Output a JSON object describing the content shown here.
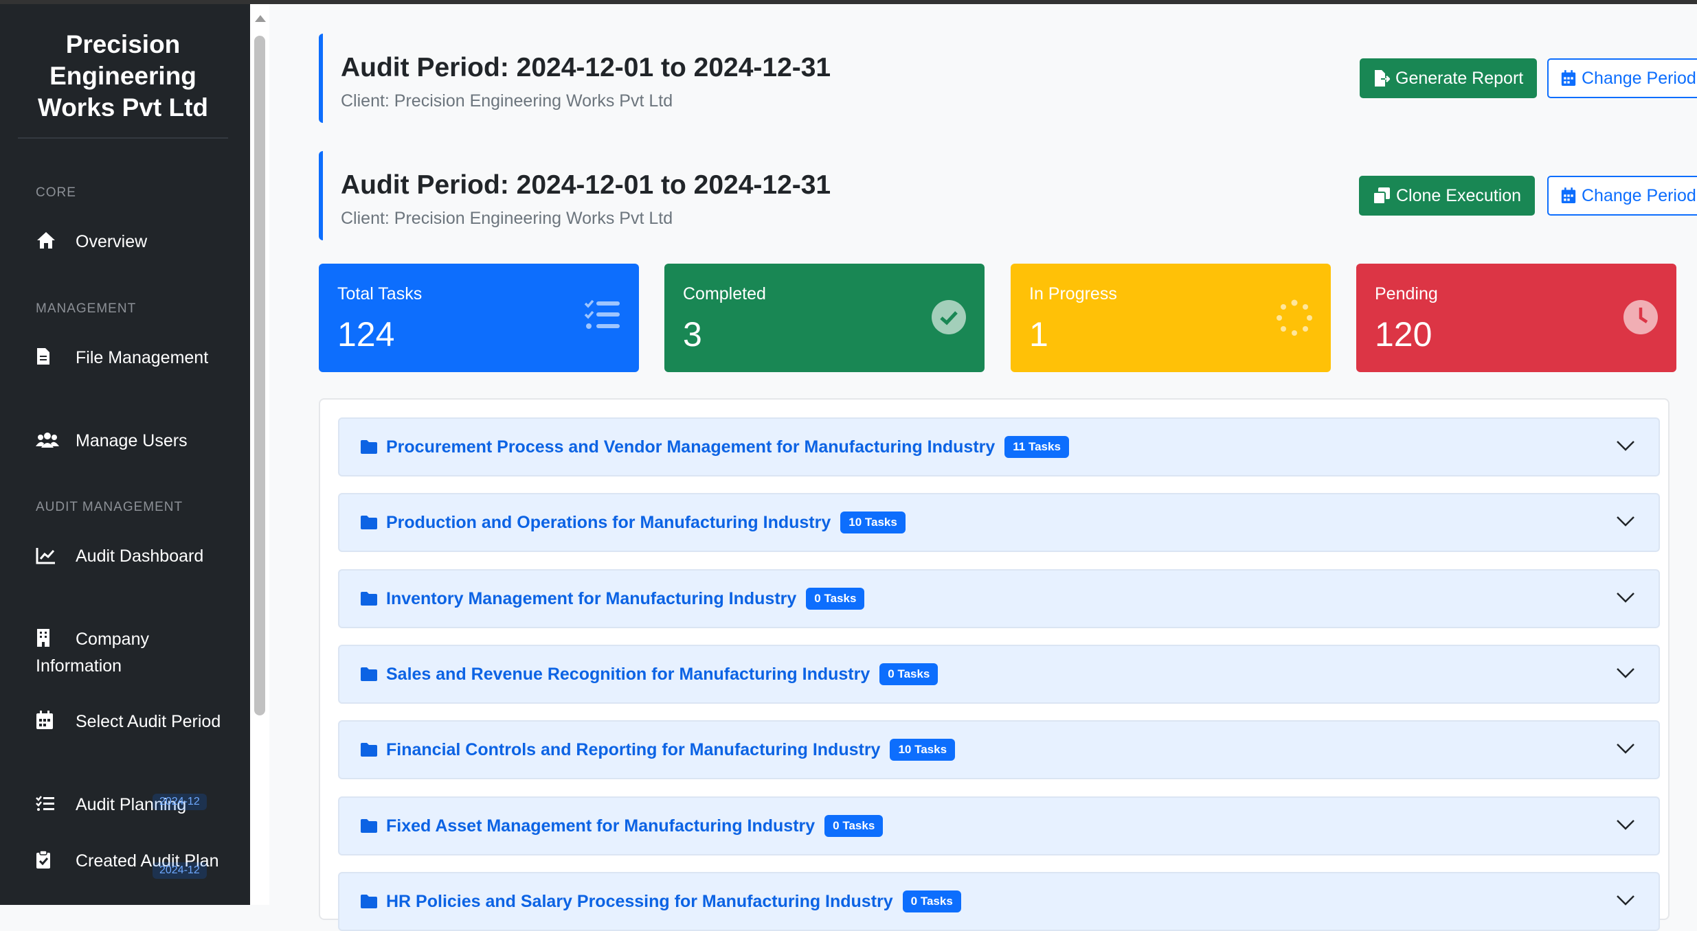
{
  "sidebar": {
    "brand": "Precision Engineering Works Pvt Ltd",
    "sections": {
      "core": "CORE",
      "management": "MANAGEMENT",
      "audit_management": "AUDIT MANAGEMENT"
    },
    "items": [
      {
        "label": "Overview",
        "icon": "home-icon"
      },
      {
        "label": "File Management",
        "icon": "file-icon"
      },
      {
        "label": "Manage Users",
        "icon": "users-icon"
      },
      {
        "label": "Audit Dashboard",
        "icon": "chart-line-icon"
      },
      {
        "label": "Company Information",
        "icon": "building-icon"
      },
      {
        "label": "Select Audit Period",
        "icon": "calendar-icon"
      },
      {
        "label": "Audit Planning",
        "icon": "list-check-icon",
        "badge": "2024-12"
      },
      {
        "label": "Created Audit Plan",
        "icon": "clipboard-check-icon",
        "badge": "2024-12"
      }
    ]
  },
  "headers": [
    {
      "title": "Audit Period: 2024-12-01 to 2024-12-31",
      "client": "Client: Precision Engineering Works Pvt Ltd",
      "primary_button": "Generate Report",
      "secondary_button": "Change Period"
    },
    {
      "title": "Audit Period: 2024-12-01 to 2024-12-31",
      "client": "Client: Precision Engineering Works Pvt Ltd",
      "primary_button": "Clone Execution",
      "secondary_button": "Change Period"
    }
  ],
  "stats": [
    {
      "label": "Total Tasks",
      "value": "124",
      "color": "#0d6efd",
      "icon": "tasks-icon"
    },
    {
      "label": "Completed",
      "value": "3",
      "color": "#198754",
      "icon": "check-circle-icon"
    },
    {
      "label": "In Progress",
      "value": "1",
      "color": "#ffc107",
      "icon": "spinner-icon"
    },
    {
      "label": "Pending",
      "value": "120",
      "color": "#dc3545",
      "icon": "clock-icon"
    }
  ],
  "categories": [
    {
      "title": "Procurement Process and Vendor Management for Manufacturing Industry",
      "badge": "11 Tasks"
    },
    {
      "title": "Production and Operations for Manufacturing Industry",
      "badge": "10 Tasks"
    },
    {
      "title": "Inventory Management for Manufacturing Industry",
      "badge": "0 Tasks"
    },
    {
      "title": "Sales and Revenue Recognition for Manufacturing Industry",
      "badge": "0 Tasks"
    },
    {
      "title": "Financial Controls and Reporting for Manufacturing Industry",
      "badge": "10 Tasks"
    },
    {
      "title": "Fixed Asset Management for Manufacturing Industry",
      "badge": "0 Tasks"
    },
    {
      "title": "HR Policies and Salary Processing for Manufacturing Industry",
      "badge": "0 Tasks"
    }
  ]
}
